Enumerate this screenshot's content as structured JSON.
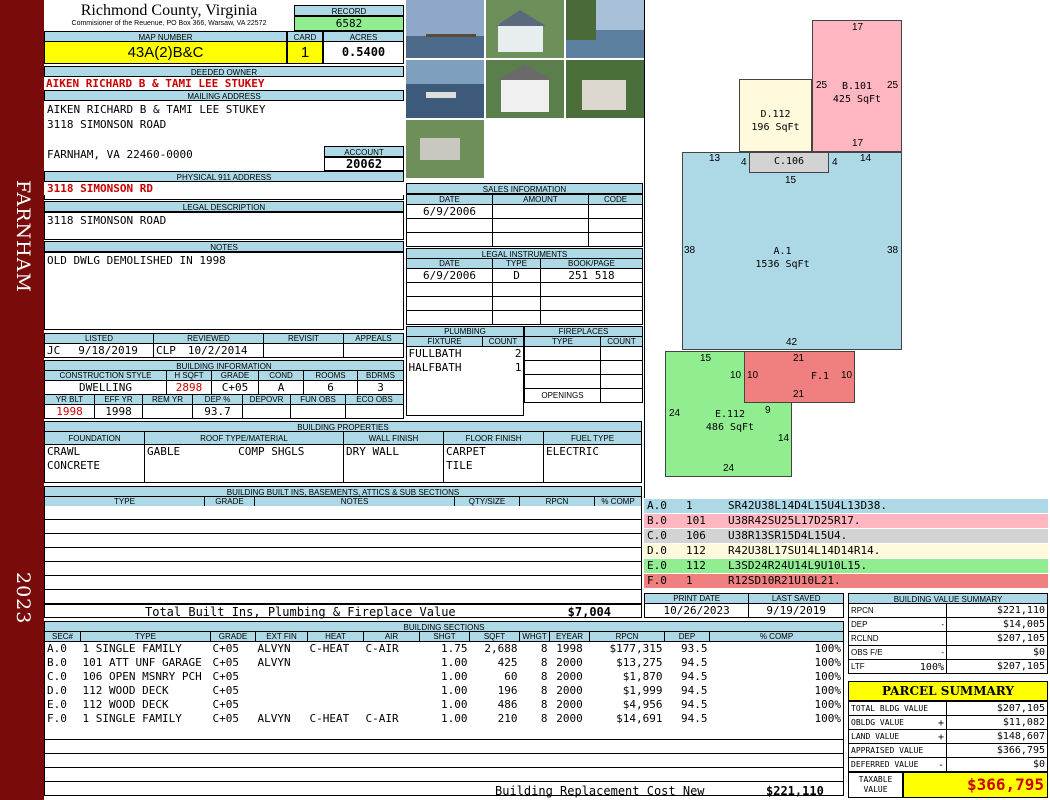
{
  "sidebar": {
    "town": "FARNHAM",
    "year": "2023"
  },
  "header": {
    "county": "Richmond County, Virginia",
    "commissioner": "Commisioner of the Reuenue, PO Box 366, Warsaw, VA 22572",
    "record_label": "RECORD",
    "record": "6582",
    "map_label": "MAP NUMBER",
    "map_number": "43A(2)B&C",
    "card_label": "CARD",
    "card": "1",
    "acres_label": "ACRES",
    "acres": "0.5400"
  },
  "owner": {
    "deeded_label": "DEEDED OWNER",
    "deeded": "AIKEN RICHARD B & TAMI LEE STUKEY",
    "mailing_label": "MAILING ADDRESS",
    "mail1": "AIKEN RICHARD B & TAMI LEE STUKEY",
    "mail2": "3118 SIMONSON ROAD",
    "mail3": "FARNHAM, VA 22460-0000",
    "account_label": "ACCOUNT",
    "account": "20062",
    "phys_label": "PHYSICAL 911 ADDRESS",
    "physical": "3118 SIMONSON RD"
  },
  "legal": {
    "label": "LEGAL DESCRIPTION",
    "text": "3118 SIMONSON ROAD"
  },
  "notes": {
    "label": "NOTES",
    "text": "OLD DWLG DEMOLISHED IN 1998"
  },
  "sales": {
    "label": "SALES INFORMATION",
    "h_date": "DATE",
    "h_amount": "AMOUNT",
    "h_code": "CODE",
    "date": "6/9/2006"
  },
  "instruments": {
    "label": "LEGAL INSTRUMENTS",
    "h_date": "DATE",
    "h_type": "TYPE",
    "h_book": "BOOK/PAGE",
    "date": "6/9/2006",
    "type": "D",
    "book": "251 518"
  },
  "review": {
    "h_listed": "LISTED",
    "h_reviewed": "REVIEWED",
    "h_revisit": "REVISIT",
    "h_appeals": "APPEALS",
    "listed_by": "JC",
    "listed": "9/18/2019",
    "reviewed_by": "CLP",
    "reviewed": "10/2/2014"
  },
  "building_info": {
    "label": "BUILDING INFORMATION",
    "h_style": "CONSTRUCTION STYLE",
    "h_hsqft": "H SQFT",
    "h_grade": "GRADE",
    "h_cond": "COND",
    "h_rooms": "ROOMS",
    "h_bdrms": "BDRMS",
    "style": "DWELLING",
    "hsqft": "2898",
    "grade": "C+05",
    "cond": "A",
    "rooms": "6",
    "bdrms": "3",
    "h_yrblt": "YR BLT",
    "h_effyr": "EFF YR",
    "h_remyr": "REM YR",
    "h_dep": "DEP %",
    "h_depovr": "DEPOVR",
    "h_funobs": "FUN OBS",
    "h_ecoobs": "ECO OBS",
    "yrblt": "1998",
    "effyr": "1998",
    "dep": "93.7"
  },
  "plumbing": {
    "label": "PLUMBING",
    "h_fixture": "FIXTURE",
    "h_count": "COUNT",
    "f1": "FULLBATH",
    "c1": "2",
    "f2": "HALFBATH",
    "c2": "1"
  },
  "fireplaces": {
    "label": "FIREPLACES",
    "h_type": "TYPE",
    "h_count": "COUNT",
    "openings": "OPENINGS"
  },
  "properties": {
    "label": "BUILDING PROPERTIES",
    "h_foundation": "FOUNDATION",
    "h_roof": "ROOF TYPE/MATERIAL",
    "h_wall": "WALL FINISH",
    "h_floor": "FLOOR FINISH",
    "h_fuel": "FUEL TYPE",
    "foundation1": "CRAWL",
    "foundation2": "CONCRETE",
    "roof_type": "GABLE",
    "roof_mat": "COMP SHGLS",
    "wall": "DRY WALL",
    "floor1": "CARPET",
    "floor2": "TILE",
    "fuel": "ELECTRIC"
  },
  "builtins": {
    "label": "BUILDING BUILT INS, BASEMENTS, ATTICS & SUB SECTIONS",
    "h_type": "TYPE",
    "h_grade": "GRADE",
    "h_notes": "NOTES",
    "h_qty": "QTY/SIZE",
    "h_rpcn": "RPCN",
    "h_comp": "% COMP",
    "total_label": "Total Built Ins, Plumbing & Fireplace Value",
    "total": "$7,004"
  },
  "sections": {
    "label": "BUILDING SECTIONS",
    "headers": [
      "SEC#",
      "TYPE",
      "GRADE",
      "EXT FIN",
      "HEAT",
      "AIR",
      "SHGT",
      "SQFT",
      "WHGT",
      "EYEAR",
      "RPCN",
      "DEP",
      "% COMP"
    ],
    "rows": [
      [
        "A.0",
        "1 SINGLE FAMILY",
        "C+05",
        "ALVYN",
        "C-HEAT",
        "C-AIR",
        "1.75",
        "2,688",
        "8",
        "1998",
        "$177,315",
        "93.5",
        "100%"
      ],
      [
        "B.0",
        "101 ATT UNF GARAGE",
        "C+05",
        "ALVYN",
        "",
        "",
        "1.00",
        "425",
        "8",
        "2000",
        "$13,275",
        "94.5",
        "100%"
      ],
      [
        "C.0",
        "106 OPEN MSNRY PCH",
        "C+05",
        "",
        "",
        "",
        "1.00",
        "60",
        "8",
        "2000",
        "$1,870",
        "94.5",
        "100%"
      ],
      [
        "D.0",
        "112 WOOD DECK",
        "C+05",
        "",
        "",
        "",
        "1.00",
        "196",
        "8",
        "2000",
        "$1,999",
        "94.5",
        "100%"
      ],
      [
        "E.0",
        "112 WOOD DECK",
        "C+05",
        "",
        "",
        "",
        "1.00",
        "486",
        "8",
        "2000",
        "$4,956",
        "94.5",
        "100%"
      ],
      [
        "F.0",
        "1 SINGLE FAMILY",
        "C+05",
        "ALVYN",
        "C-HEAT",
        "C-AIR",
        "1.00",
        "210",
        "8",
        "2000",
        "$14,691",
        "94.5",
        "100%"
      ]
    ],
    "brcn_label": "Building Replacement Cost New",
    "brcn": "$221,110"
  },
  "sketch": {
    "a": {
      "name": "A.1",
      "area": "1536 SqFt",
      "left": "38",
      "right": "38",
      "bottom": "42",
      "top_l": "13",
      "top_r": "14",
      "top_c": "15"
    },
    "b": {
      "name": "B.101",
      "area": "425 SqFt",
      "top": "17",
      "left": "25",
      "right": "25",
      "bottom": "17"
    },
    "c": {
      "name": "C.106",
      "l": "4",
      "r": "4"
    },
    "d": {
      "name": "D.112",
      "area": "196 SqFt"
    },
    "e": {
      "name": "E.112",
      "area": "486 SqFt",
      "top": "15",
      "left": "24",
      "bottom": "24",
      "inner": "10",
      "r1": "9",
      "r2": "14"
    },
    "f": {
      "name": "F.1",
      "top": "21",
      "left": "10",
      "right": "10",
      "bottom": "21"
    }
  },
  "legend": [
    {
      "sec": "A.0",
      "code": "1",
      "path": "SR42U38L14D4L15U4L13D38.",
      "color": "#add8e6"
    },
    {
      "sec": "B.0",
      "code": "101",
      "path": "U38R42SU25L17D25R17.",
      "color": "#ffb6c1"
    },
    {
      "sec": "C.0",
      "code": "106",
      "path": "U38R13SR15D4L15U4.",
      "color": "#d3d3d3"
    },
    {
      "sec": "D.0",
      "code": "112",
      "path": "R42U38L17SU14L14D14R14.",
      "color": "#fffadc"
    },
    {
      "sec": "E.0",
      "code": "112",
      "path": "L3SD24R24U14L9U10L15.",
      "color": "#90ee90"
    },
    {
      "sec": "F.0",
      "code": "1",
      "path": "R12SD10R21U10L21.",
      "color": "#f08080"
    }
  ],
  "dates": {
    "print_label": "PRINT DATE",
    "print": "10/26/2023",
    "saved_label": "LAST SAVED",
    "saved": "9/19/2019"
  },
  "value_summary": {
    "label": "BUILDING VALUE SUMMARY",
    "rpcn_l": "RPCN",
    "rpcn": "$221,110",
    "dep_l": "DEP",
    "dep_s": "-",
    "dep": "$14,005",
    "rclnd_l": "RCLND",
    "rclnd": "$207,105",
    "obs_l": "OBS F/E",
    "obs_s": "-",
    "obs": "$0",
    "ltr_l": "LTF",
    "ltr_p": "100%",
    "ltr": "$207,105"
  },
  "parcel": {
    "label": "PARCEL SUMMARY",
    "bldg_l": "TOTAL BLDG VALUE",
    "bldg": "$207,105",
    "obldg_l": "OBLDG VALUE",
    "obldg_s": "+",
    "obldg": "$11,082",
    "land_l": "LAND VALUE",
    "land_s": "+",
    "land": "$148,607",
    "appr_l": "APPRAISED VALUE",
    "appr": "$366,795",
    "def_l": "DEFERRED VALUE",
    "def_s": "-",
    "def": "$0",
    "tax_l1": "TAXABLE",
    "tax_l2": "VALUE",
    "tax": "$366,795"
  }
}
